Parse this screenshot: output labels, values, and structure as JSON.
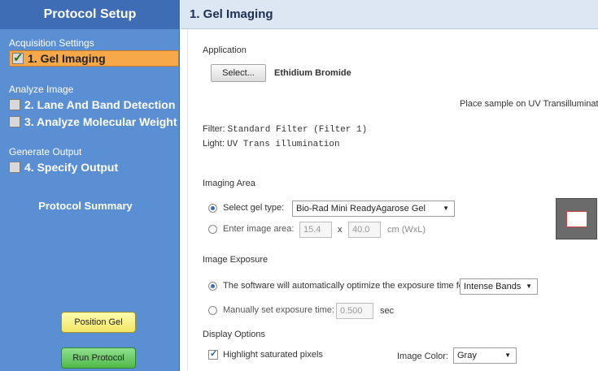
{
  "sidebar": {
    "title": "Protocol Setup",
    "groups": {
      "acquisition": "Acquisition Settings",
      "analyze": "Analyze Image",
      "output": "Generate Output"
    },
    "steps": {
      "gel_imaging": {
        "label": "1. Gel Imaging",
        "checked": true,
        "active": true
      },
      "lane_band": {
        "label": "2. Lane And Band Detection",
        "checked": false
      },
      "molecular_weight": {
        "label": "3. Analyze Molecular Weight",
        "checked": false
      },
      "specify_output": {
        "label": "4. Specify Output",
        "checked": false
      }
    },
    "summary_label": "Protocol Summary",
    "position_gel_label": "Position Gel",
    "run_protocol_label": "Run Protocol"
  },
  "main": {
    "title": "1. Gel Imaging",
    "application": {
      "section_label": "Application",
      "select_button": "Select...",
      "value": "Ethidium Bromide",
      "instruction": "Place sample on UV Transilluminator"
    },
    "filter": {
      "label": "Filter:",
      "value": "Standard Filter (Filter 1)"
    },
    "light": {
      "label": "Light:",
      "value": "UV Trans illumination"
    },
    "imaging_area": {
      "section_label": "Imaging Area",
      "select_gel_label": "Select gel type:",
      "gel_type": "Bio-Rad Mini ReadyAgarose Gel",
      "enter_area_label": "Enter image area:",
      "width": "15.4",
      "times": "x",
      "height": "40.0",
      "unit": "cm (WxL)"
    },
    "image_exposure": {
      "section_label": "Image Exposure",
      "auto_label": "The software will automatically optimize the exposure time for",
      "auto_option": "Intense Bands",
      "manual_label": "Manually set exposure time:",
      "manual_value": "0.500",
      "manual_unit": "sec"
    },
    "display_options": {
      "section_label": "Display Options",
      "highlight_label": "Highlight saturated pixels",
      "color_label": "Image Color:",
      "color_value": "Gray"
    }
  },
  "colors": {
    "sidebar_bg": "#5b8fd4",
    "active_step": "#f7a94a",
    "position_button": "#f0e564",
    "run_button": "#4fba4a"
  }
}
